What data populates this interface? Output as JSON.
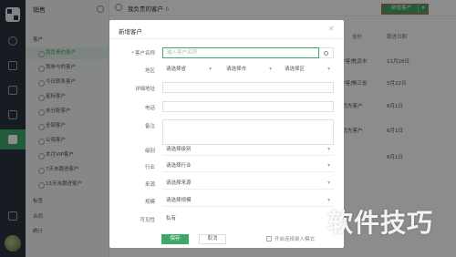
{
  "sidebar": {
    "title": "销售",
    "groups": [
      {
        "label": "客户"
      },
      {
        "label": "标签"
      },
      {
        "label": "合同"
      },
      {
        "label": "统计"
      }
    ],
    "items": [
      {
        "label": "我负责的客户"
      },
      {
        "label": "我参与的客户"
      },
      {
        "label": "今日联系客户"
      },
      {
        "label": "星标客户"
      },
      {
        "label": "未分配客户"
      },
      {
        "label": "全部客户"
      },
      {
        "label": "公海客户"
      },
      {
        "label": "本月VIP客户"
      },
      {
        "label": "7天未跟进客户"
      },
      {
        "label": "15天未跟进客户"
      }
    ]
  },
  "header": {
    "title": "我负责的客户",
    "count": "6",
    "new_button": "新增客户"
  },
  "table": {
    "headers": [
      "省份",
      "跟进日期"
    ],
    "rows": [
      {
        "name": "VIP客户",
        "province": "北京市",
        "date": "11月28日"
      },
      {
        "name": "VIP客户",
        "province": "浙江省",
        "date": "5月22日"
      },
      {
        "name": "位优先客户",
        "province": "",
        "date": "6月1日"
      },
      {
        "name": "位优先客户",
        "province": "",
        "date": "6月1日"
      },
      {
        "name": "",
        "province": "",
        "date": "6月1日"
      }
    ]
  },
  "modal": {
    "title": "新增客户",
    "fields": {
      "name_label": "客户名称",
      "name_placeholder": "输入客户名称",
      "region_label": "地区",
      "province": "请选择省",
      "city": "请选择市",
      "district": "请选择区",
      "address_label": "详细地址",
      "phone_label": "电话",
      "note_label": "备注",
      "level_label": "级别",
      "level_value": "请选择级别",
      "industry_label": "行业",
      "industry_value": "请选择行业",
      "source_label": "来源",
      "source_value": "请选择来源",
      "scale_label": "规模",
      "scale_value": "请选择规模",
      "visibility_label": "可见性",
      "visibility_value": "私有"
    },
    "save": "保存",
    "cancel": "取消",
    "continue_label": "开启连续录入模式"
  },
  "watermark": "软件技巧",
  "colors": {
    "accent": "#3ea86a",
    "rail": "#2b3440",
    "highlight": "#e9553a"
  }
}
